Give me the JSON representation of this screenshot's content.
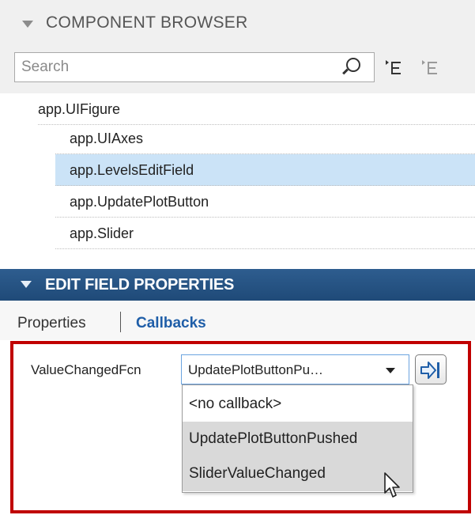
{
  "component_browser": {
    "title": "COMPONENT BROWSER",
    "search": {
      "placeholder": "Search",
      "value": ""
    },
    "toolbar_icons": [
      "search-icon",
      "expand-tree-icon",
      "collapse-tree-icon"
    ],
    "tree": [
      {
        "label": "app.UIFigure",
        "level": 0,
        "selected": false
      },
      {
        "label": "app.UIAxes",
        "level": 1,
        "selected": false
      },
      {
        "label": "app.LevelsEditField",
        "level": 1,
        "selected": true
      },
      {
        "label": "app.UpdatePlotButton",
        "level": 1,
        "selected": false
      },
      {
        "label": "app.Slider",
        "level": 1,
        "selected": false
      }
    ]
  },
  "edit_field_properties": {
    "title": "EDIT FIELD PROPERTIES",
    "tabs": [
      {
        "label": "Properties",
        "active": false
      },
      {
        "label": "Callbacks",
        "active": true
      }
    ],
    "callback": {
      "label": "ValueChangedFcn",
      "selected_value": "UpdatePlotButtonPu…",
      "options": [
        "<no callback>",
        "UpdatePlotButtonPushed",
        "SliderValueChanged"
      ],
      "highlighted_option": "UpdatePlotButtonPushed",
      "hovered_option": "SliderValueChanged"
    },
    "goto_icon": "go-to-callback-icon"
  },
  "colors": {
    "header_blue": "#1f4a78",
    "selection_blue": "#cbe3f7",
    "callbacks_tab": "#1f5ea8",
    "highlight_border": "#c00000"
  }
}
